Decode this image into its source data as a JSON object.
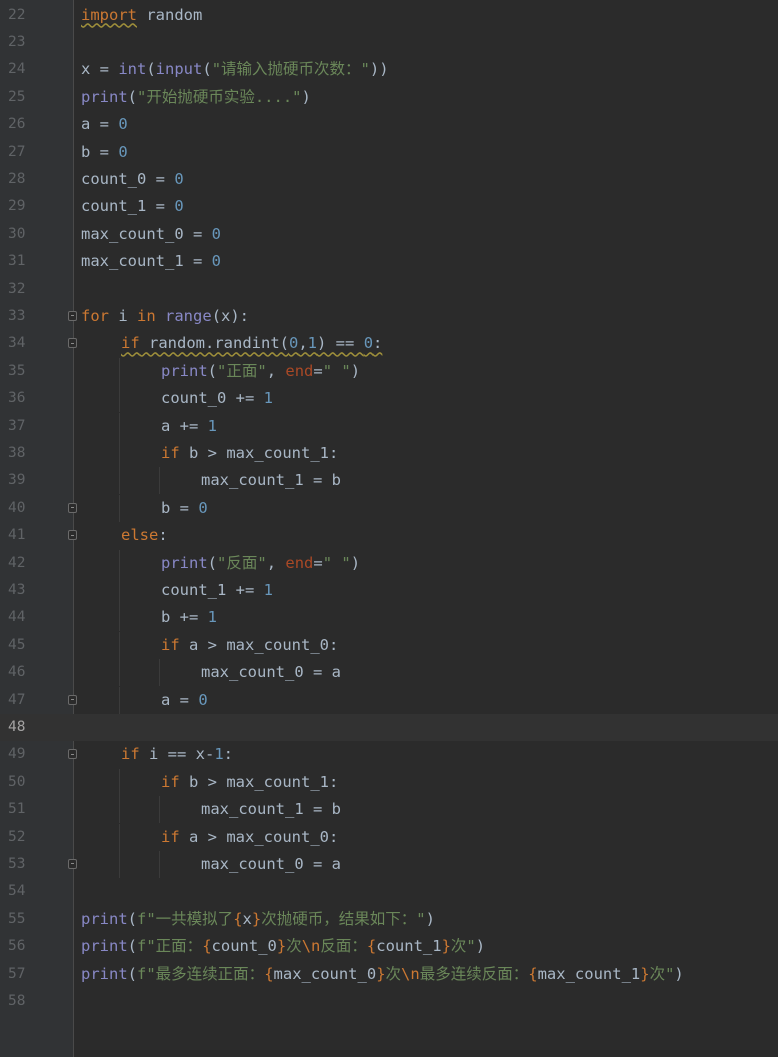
{
  "editor": {
    "lines": [
      {
        "no": "22",
        "indent": 0,
        "tokens": [
          [
            "k u",
            "import"
          ],
          [
            "t",
            " random"
          ]
        ]
      },
      {
        "no": "23",
        "indent": 0,
        "tokens": []
      },
      {
        "no": "24",
        "indent": 0,
        "tokens": [
          [
            "t",
            "x = "
          ],
          [
            "f",
            "int"
          ],
          [
            "t",
            "("
          ],
          [
            "f",
            "input"
          ],
          [
            "t",
            "("
          ],
          [
            "s",
            "\"请输入抛硬币次数：\""
          ],
          [
            "t",
            "))"
          ]
        ]
      },
      {
        "no": "25",
        "indent": 0,
        "tokens": [
          [
            "f",
            "print"
          ],
          [
            "t",
            "("
          ],
          [
            "s",
            "\"开始抛硬币实验....\""
          ],
          [
            "t",
            ")"
          ]
        ]
      },
      {
        "no": "26",
        "indent": 0,
        "tokens": [
          [
            "t",
            "a = "
          ],
          [
            "n",
            "0"
          ]
        ]
      },
      {
        "no": "27",
        "indent": 0,
        "tokens": [
          [
            "t",
            "b = "
          ],
          [
            "n",
            "0"
          ]
        ]
      },
      {
        "no": "28",
        "indent": 0,
        "tokens": [
          [
            "t",
            "count_0 = "
          ],
          [
            "n",
            "0"
          ]
        ]
      },
      {
        "no": "29",
        "indent": 0,
        "tokens": [
          [
            "t",
            "count_1 = "
          ],
          [
            "n",
            "0"
          ]
        ]
      },
      {
        "no": "30",
        "indent": 0,
        "tokens": [
          [
            "t",
            "max_count_0 = "
          ],
          [
            "n",
            "0"
          ]
        ]
      },
      {
        "no": "31",
        "indent": 0,
        "tokens": [
          [
            "t",
            "max_count_1 = "
          ],
          [
            "n",
            "0"
          ]
        ]
      },
      {
        "no": "32",
        "indent": 0,
        "tokens": []
      },
      {
        "no": "33",
        "indent": 0,
        "fold": true,
        "tokens": [
          [
            "k",
            "for"
          ],
          [
            "t",
            " i "
          ],
          [
            "k",
            "in"
          ],
          [
            "t",
            " "
          ],
          [
            "f",
            "range"
          ],
          [
            "t",
            "(x):"
          ]
        ]
      },
      {
        "no": "34",
        "indent": 1,
        "fold": true,
        "squiggle": true,
        "tokens": [
          [
            "k",
            "if"
          ],
          [
            "t",
            " random.randint("
          ],
          [
            "n",
            "0"
          ],
          [
            "t",
            ","
          ],
          [
            "n",
            "1"
          ],
          [
            "t",
            ") == "
          ],
          [
            "n",
            "0"
          ],
          [
            "t",
            ":"
          ]
        ]
      },
      {
        "no": "35",
        "indent": 2,
        "tokens": [
          [
            "f",
            "print"
          ],
          [
            "t",
            "("
          ],
          [
            "s",
            "\"正面\""
          ],
          [
            "t",
            ", "
          ],
          [
            "p",
            "end"
          ],
          [
            "t",
            "="
          ],
          [
            "s",
            "\" \""
          ],
          [
            "t",
            ")"
          ]
        ]
      },
      {
        "no": "36",
        "indent": 2,
        "tokens": [
          [
            "t",
            "count_0 += "
          ],
          [
            "n",
            "1"
          ]
        ]
      },
      {
        "no": "37",
        "indent": 2,
        "tokens": [
          [
            "t",
            "a += "
          ],
          [
            "n",
            "1"
          ]
        ]
      },
      {
        "no": "38",
        "indent": 2,
        "tokens": [
          [
            "k",
            "if"
          ],
          [
            "t",
            " b > max_count_1:"
          ]
        ]
      },
      {
        "no": "39",
        "indent": 3,
        "tokens": [
          [
            "t",
            "max_count_1 = b"
          ]
        ]
      },
      {
        "no": "40",
        "indent": 2,
        "fold": true,
        "tokens": [
          [
            "t",
            "b = "
          ],
          [
            "n",
            "0"
          ]
        ]
      },
      {
        "no": "41",
        "indent": 1,
        "fold": true,
        "tokens": [
          [
            "k",
            "else"
          ],
          [
            "t",
            ":"
          ]
        ]
      },
      {
        "no": "42",
        "indent": 2,
        "tokens": [
          [
            "f",
            "print"
          ],
          [
            "t",
            "("
          ],
          [
            "s",
            "\"反面\""
          ],
          [
            "t",
            ", "
          ],
          [
            "p",
            "end"
          ],
          [
            "t",
            "="
          ],
          [
            "s",
            "\" \""
          ],
          [
            "t",
            ")"
          ]
        ]
      },
      {
        "no": "43",
        "indent": 2,
        "tokens": [
          [
            "t",
            "count_1 += "
          ],
          [
            "n",
            "1"
          ]
        ]
      },
      {
        "no": "44",
        "indent": 2,
        "tokens": [
          [
            "t",
            "b += "
          ],
          [
            "n",
            "1"
          ]
        ]
      },
      {
        "no": "45",
        "indent": 2,
        "tokens": [
          [
            "k",
            "if"
          ],
          [
            "t",
            " a > max_count_0:"
          ]
        ]
      },
      {
        "no": "46",
        "indent": 3,
        "tokens": [
          [
            "t",
            "max_count_0 = a"
          ]
        ]
      },
      {
        "no": "47",
        "indent": 2,
        "fold": true,
        "tokens": [
          [
            "t",
            "a = "
          ],
          [
            "n",
            "0"
          ]
        ]
      },
      {
        "no": "48",
        "indent": 0,
        "current": true,
        "tokens": []
      },
      {
        "no": "49",
        "indent": 1,
        "fold": true,
        "tokens": [
          [
            "k",
            "if"
          ],
          [
            "t",
            " i == x-"
          ],
          [
            "n",
            "1"
          ],
          [
            "t",
            ":"
          ]
        ]
      },
      {
        "no": "50",
        "indent": 2,
        "tokens": [
          [
            "k",
            "if"
          ],
          [
            "t",
            " b > max_count_1:"
          ]
        ]
      },
      {
        "no": "51",
        "indent": 3,
        "tokens": [
          [
            "t",
            "max_count_1 = b"
          ]
        ]
      },
      {
        "no": "52",
        "indent": 2,
        "tokens": [
          [
            "k",
            "if"
          ],
          [
            "t",
            " a > max_count_0:"
          ]
        ]
      },
      {
        "no": "53",
        "indent": 3,
        "fold": true,
        "tokens": [
          [
            "t",
            "max_count_0 = a"
          ]
        ]
      },
      {
        "no": "54",
        "indent": 0,
        "tokens": []
      },
      {
        "no": "55",
        "indent": 0,
        "tokens": [
          [
            "f",
            "print"
          ],
          [
            "t",
            "("
          ],
          [
            "s",
            "f\"一共模拟了"
          ],
          [
            "b",
            "{"
          ],
          [
            "t",
            "x"
          ],
          [
            "b",
            "}"
          ],
          [
            "s",
            "次抛硬币，结果如下：\""
          ],
          [
            "t",
            ")"
          ]
        ]
      },
      {
        "no": "56",
        "indent": 0,
        "tokens": [
          [
            "f",
            "print"
          ],
          [
            "t",
            "("
          ],
          [
            "s",
            "f\"正面："
          ],
          [
            "b",
            "{"
          ],
          [
            "t",
            "count_0"
          ],
          [
            "b",
            "}"
          ],
          [
            "s",
            "次"
          ],
          [
            "e",
            "\\n"
          ],
          [
            "s",
            "反面："
          ],
          [
            "b",
            "{"
          ],
          [
            "t",
            "count_1"
          ],
          [
            "b",
            "}"
          ],
          [
            "s",
            "次\""
          ],
          [
            "t",
            ")"
          ]
        ]
      },
      {
        "no": "57",
        "indent": 0,
        "tokens": [
          [
            "f",
            "print"
          ],
          [
            "t",
            "("
          ],
          [
            "s",
            "f\"最多连续正面："
          ],
          [
            "b",
            "{"
          ],
          [
            "t",
            "max_count_0"
          ],
          [
            "b",
            "}"
          ],
          [
            "s",
            "次"
          ],
          [
            "e",
            "\\n"
          ],
          [
            "s",
            "最多连续反面："
          ],
          [
            "b",
            "{"
          ],
          [
            "t",
            "max_count_1"
          ],
          [
            "b",
            "}"
          ],
          [
            "s",
            "次\""
          ],
          [
            "t",
            ")"
          ]
        ]
      },
      {
        "no": "58",
        "indent": 0,
        "tokens": []
      }
    ]
  }
}
